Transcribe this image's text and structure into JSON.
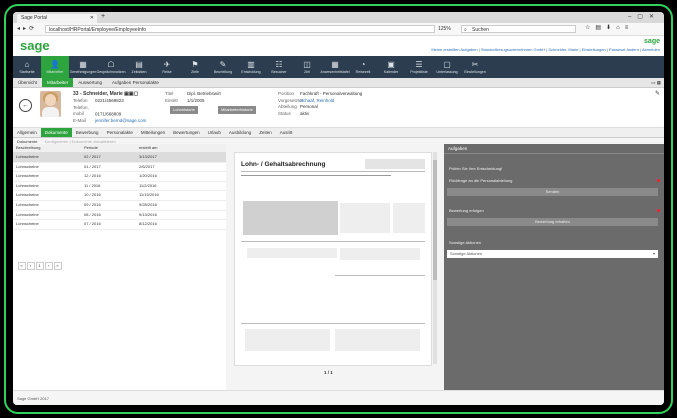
{
  "browser": {
    "tab_title": "Sage Portal",
    "url": "localhost/HRPortal/Employee/EmployeeInfo",
    "zoom": "125%",
    "search_placeholder": "Suchen"
  },
  "header": {
    "logo": "sage",
    "user_line": "Meine erstellten Aufgaben | Standortbezugsunternehmen GmbH | Schneider, Marie | Einstellungen | Passwort ändern | Abmelden",
    "logo_small": "sage"
  },
  "modules": [
    {
      "label": "Startseite",
      "icon": "home-icon",
      "glyph": "⌂"
    },
    {
      "label": "Mitarbeiter",
      "icon": "person-icon",
      "glyph": "👤"
    },
    {
      "label": "Genehmigungen",
      "icon": "approval-icon",
      "glyph": "▦"
    },
    {
      "label": "Gesprächsnotizen",
      "icon": "notes-icon",
      "glyph": "☖"
    },
    {
      "label": "Zeitdaten",
      "icon": "calendar-icon",
      "glyph": "▤"
    },
    {
      "label": "Reise",
      "icon": "plane-icon",
      "glyph": "✈"
    },
    {
      "label": "Ziele",
      "icon": "flag-icon",
      "glyph": "⚑"
    },
    {
      "label": "Beurteilung",
      "icon": "edit-icon",
      "glyph": "✎"
    },
    {
      "label": "Entwicklung",
      "icon": "chart-icon",
      "glyph": "▥"
    },
    {
      "label": "Besucher",
      "icon": "visitors-icon",
      "glyph": "☷"
    },
    {
      "label": "Ziel",
      "icon": "target-icon",
      "glyph": "◫"
    },
    {
      "label": "Anwesenheitstafel",
      "icon": "grid-icon",
      "glyph": "▦"
    },
    {
      "label": "Reisezeit",
      "icon": "clock-icon",
      "glyph": "◔"
    },
    {
      "label": "Kalender",
      "icon": "calendar2-icon",
      "glyph": "▣"
    },
    {
      "label": "Projektliste",
      "icon": "list-icon",
      "glyph": "☰"
    },
    {
      "label": "Unterlassung",
      "icon": "doc-icon",
      "glyph": "▢"
    },
    {
      "label": "Einstellungen",
      "icon": "wrench-icon",
      "glyph": "✂"
    }
  ],
  "subtabs": [
    "Übersicht",
    "Mitarbeiter",
    "Auswertung",
    "Aufgaben Personalakte"
  ],
  "employee": {
    "id_name": "33 - Schneider, Marie",
    "left_fields": [
      {
        "k": "Telefon",
        "v": "0221/4569823"
      },
      {
        "k": "Telefon, mobil",
        "v": "0171/668809"
      },
      {
        "k": "E-Mail",
        "v": "jennifer.bernd@sage.com"
      }
    ],
    "mid_fields": [
      {
        "k": "Titel",
        "v": "Dipl. Betriebswirt"
      },
      {
        "k": "Eintritt",
        "v": "1/1/2005"
      }
    ],
    "right_fields": [
      {
        "k": "Position",
        "v": "Fachkraft - Personalverwaltung"
      },
      {
        "k": "Vorgesetzter",
        "v": "Schaaf, Reinhold"
      },
      {
        "k": "Abteilung",
        "v": "Personal"
      },
      {
        "k": "Status",
        "v": "aktiv"
      }
    ],
    "btn_primary": "Lohnhistorie",
    "btn_secondary": "Mitarbeiterhistorie"
  },
  "detail_tabs": [
    "Allgemein",
    "Dokumente",
    "Bewerbung",
    "Personalakte",
    "Mitteilungen",
    "Bewertungen",
    "Urlaub",
    "Ausbildung",
    "Zeiten",
    "Ausritt"
  ],
  "docstrip": {
    "label": "Dokumente",
    "disabled": "Konfigurieren | Dokumente aktualisieren"
  },
  "table": {
    "headers": [
      "Beschreibung",
      "Periode",
      "erstellt am"
    ],
    "rows": [
      [
        "Lohnscheine",
        "02 / 2017",
        "3/13/2017"
      ],
      [
        "Lohnscheine",
        "01 / 2017",
        "2/6/2017"
      ],
      [
        "Lohnscheine",
        "12 / 2016",
        "1/20/2016"
      ],
      [
        "Lohnscheine",
        "11 / 2016",
        "11/2/2016"
      ],
      [
        "Lohnscheine",
        "10 / 2016",
        "11/15/2016"
      ],
      [
        "Lohnscheine",
        "09 / 2016",
        "9/28/2016"
      ],
      [
        "Lohnscheine",
        "08 / 2016",
        "9/13/2016"
      ],
      [
        "Lohnscheine",
        "07 / 2016",
        "8/12/2016"
      ]
    ],
    "pager": [
      "«",
      "‹",
      "1",
      "›",
      "»"
    ]
  },
  "preview": {
    "title": "Lohn- / Gehaltsabrechnung",
    "page": "1 / 1"
  },
  "panel": {
    "title": "Aufgaben",
    "question": "Prüfen Sie Ihre Entscheidung!",
    "item1": "Rückfrage an die Personalabteilung",
    "bar1": "Senden",
    "item2": "Bewertung erfolgen",
    "bar2": "Bewertung erhalten",
    "label3": "Sonstige Aktionen",
    "select3": "Sonstige Aktionen"
  },
  "footer": {
    "text": "Sage GmbH 2017"
  },
  "colors": {
    "accent": "#2ea43f",
    "nav": "#2b3d4f",
    "panel": "#6b6b6b",
    "frame": "#2fd25a"
  }
}
